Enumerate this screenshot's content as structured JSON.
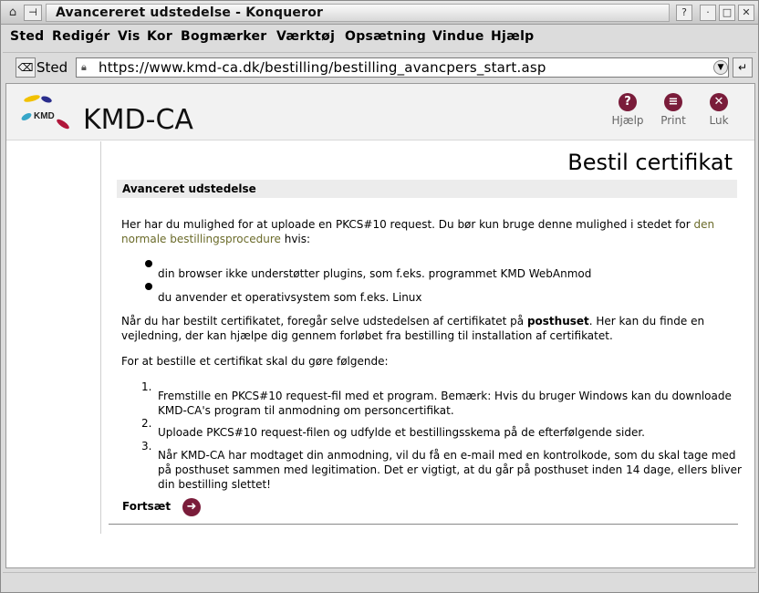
{
  "window": {
    "title": "Avancereret udstedelse  - Konqueror",
    "help_button": "?",
    "minimize_button": "·",
    "maximize_button": "□",
    "close_button": "✕"
  },
  "menu": [
    "Sted",
    "Redigér",
    "Vis",
    "Kor",
    "Bogmærker",
    "Værktøj",
    "Opsætning",
    "Vindue",
    "Hjælp"
  ],
  "location": {
    "label": "Sted",
    "url": "https://www.kmd-ca.dk/bestilling/bestilling_avancpers_start.asp"
  },
  "site": {
    "logo_text": "KMD",
    "title": "KMD-CA",
    "header_buttons": [
      {
        "label": "Hjælp",
        "glyph": "?"
      },
      {
        "label": "Print",
        "glyph": "≡"
      },
      {
        "label": "Luk",
        "glyph": "✕"
      }
    ],
    "accent_color": "#7a1c3a"
  },
  "page": {
    "heading": "Bestil certifikat",
    "section": "Avanceret udstedelse",
    "intro_before_link": "Her har du mulighed for at uploade en PKCS#10 request. Du bør kun bruge denne mulighed i stedet for ",
    "intro_link": "den normale bestillingsprocedure",
    "intro_after_link": " hvis:",
    "bullets": [
      "din browser ikke understøtter plugins, som f.eks. programmet KMD WebAnmod",
      "du anvender et operativsystem som f.eks. Linux"
    ],
    "para2_before_bold": "Når du har bestilt certifikatet, foregår selve udstedelsen af certifikatet på ",
    "para2_bold": "posthuset",
    "para2_after_bold": ". Her kan du finde en vejledning, der kan hjælpe dig gennem forløbet fra bestilling til installation af certifikatet.",
    "para3": "For at bestille et certifikat skal du gøre følgende:",
    "steps": [
      {
        "num": "1.",
        "text": "Fremstille en PKCS#10 request-fil med et program. Bemærk: Hvis du bruger Windows kan du downloade KMD-CA's program til anmodning om personcertifikat."
      },
      {
        "num": "2.",
        "text": "Uploade PKCS#10 request-filen og udfylde et bestillingsskema på de efterfølgende sider."
      },
      {
        "num": "3.",
        "text": "Når KMD-CA har modtaget din anmodning, vil du få en e-mail med en kontrolkode, som du skal tage med på posthuset sammen med legitimation. Det er vigtigt, at du går på posthuset inden 14 dage, ellers bliver din bestilling slettet!"
      }
    ],
    "continue_label": "Fortsæt",
    "continue_glyph": "➜"
  }
}
